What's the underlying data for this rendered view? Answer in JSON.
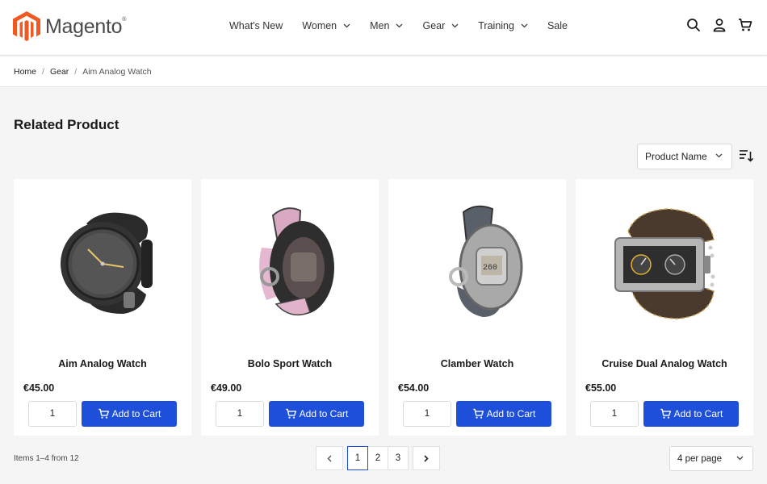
{
  "brand": {
    "name": "Magento",
    "mark": "®",
    "accent": "#ef5a23"
  },
  "nav": [
    {
      "label": "What's New",
      "dropdown": false
    },
    {
      "label": "Women",
      "dropdown": true
    },
    {
      "label": "Men",
      "dropdown": true
    },
    {
      "label": "Gear",
      "dropdown": true
    },
    {
      "label": "Training",
      "dropdown": true
    },
    {
      "label": "Sale",
      "dropdown": false
    }
  ],
  "header_icons": [
    "search-icon",
    "user-icon",
    "cart-icon"
  ],
  "breadcrumb": [
    "Home",
    "Gear",
    "Aim Analog Watch"
  ],
  "page_title": "Related Product",
  "sort": {
    "selected": "Product Name"
  },
  "products": [
    {
      "name": "Aim Analog Watch",
      "price": "€45.00",
      "qty": "1",
      "add_label": "Add to Cart"
    },
    {
      "name": "Bolo Sport Watch",
      "price": "€49.00",
      "qty": "1",
      "add_label": "Add to Cart"
    },
    {
      "name": "Clamber Watch",
      "price": "€54.00",
      "qty": "1",
      "add_label": "Add to Cart"
    },
    {
      "name": "Cruise Dual Analog Watch",
      "price": "€55.00",
      "qty": "1",
      "add_label": "Add to Cart"
    }
  ],
  "toolbar": {
    "items_count": "Items 1–4 from 12",
    "pages": [
      "1",
      "2",
      "3"
    ],
    "current_page": "1",
    "per_page": "4 per page"
  },
  "colors": {
    "primary": "#1d4fdb",
    "background": "#f5f5f5"
  }
}
